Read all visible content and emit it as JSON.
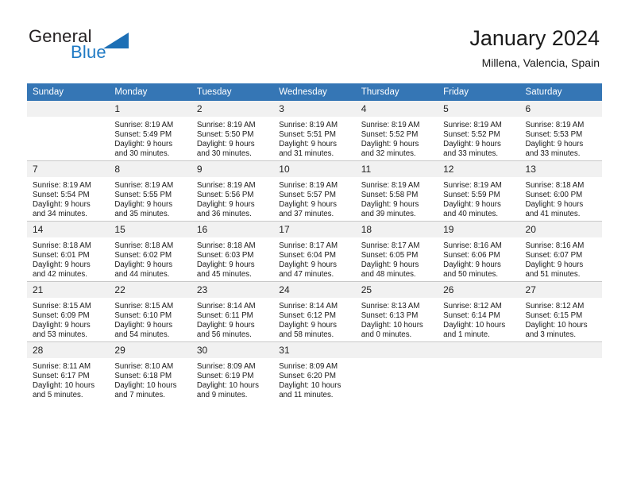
{
  "brand": {
    "name_part1": "General",
    "name_part2": "Blue",
    "logo_icon": "triangle-flag-icon"
  },
  "header": {
    "title": "January 2024",
    "subtitle": "Millena, Valencia, Spain"
  },
  "colors": {
    "header_blue": "#3576b5",
    "brand_blue": "#1f7ac4",
    "daynum_band": "#f1f1f1",
    "grid_line": "#c8c8c8"
  },
  "weekday_headers": [
    "Sunday",
    "Monday",
    "Tuesday",
    "Wednesday",
    "Thursday",
    "Friday",
    "Saturday"
  ],
  "labels": {
    "sunrise_prefix": "Sunrise:",
    "sunset_prefix": "Sunset:",
    "daylight_prefix": "Daylight:"
  },
  "weeks": [
    [
      {
        "day": "",
        "sunrise": "",
        "sunset": "",
        "daylight1": "",
        "daylight2": "",
        "empty": true
      },
      {
        "day": "1",
        "sunrise": "Sunrise: 8:19 AM",
        "sunset": "Sunset: 5:49 PM",
        "daylight1": "Daylight: 9 hours",
        "daylight2": "and 30 minutes.",
        "empty": false
      },
      {
        "day": "2",
        "sunrise": "Sunrise: 8:19 AM",
        "sunset": "Sunset: 5:50 PM",
        "daylight1": "Daylight: 9 hours",
        "daylight2": "and 30 minutes.",
        "empty": false
      },
      {
        "day": "3",
        "sunrise": "Sunrise: 8:19 AM",
        "sunset": "Sunset: 5:51 PM",
        "daylight1": "Daylight: 9 hours",
        "daylight2": "and 31 minutes.",
        "empty": false
      },
      {
        "day": "4",
        "sunrise": "Sunrise: 8:19 AM",
        "sunset": "Sunset: 5:52 PM",
        "daylight1": "Daylight: 9 hours",
        "daylight2": "and 32 minutes.",
        "empty": false
      },
      {
        "day": "5",
        "sunrise": "Sunrise: 8:19 AM",
        "sunset": "Sunset: 5:52 PM",
        "daylight1": "Daylight: 9 hours",
        "daylight2": "and 33 minutes.",
        "empty": false
      },
      {
        "day": "6",
        "sunrise": "Sunrise: 8:19 AM",
        "sunset": "Sunset: 5:53 PM",
        "daylight1": "Daylight: 9 hours",
        "daylight2": "and 33 minutes.",
        "empty": false
      }
    ],
    [
      {
        "day": "7",
        "sunrise": "Sunrise: 8:19 AM",
        "sunset": "Sunset: 5:54 PM",
        "daylight1": "Daylight: 9 hours",
        "daylight2": "and 34 minutes.",
        "empty": false
      },
      {
        "day": "8",
        "sunrise": "Sunrise: 8:19 AM",
        "sunset": "Sunset: 5:55 PM",
        "daylight1": "Daylight: 9 hours",
        "daylight2": "and 35 minutes.",
        "empty": false
      },
      {
        "day": "9",
        "sunrise": "Sunrise: 8:19 AM",
        "sunset": "Sunset: 5:56 PM",
        "daylight1": "Daylight: 9 hours",
        "daylight2": "and 36 minutes.",
        "empty": false
      },
      {
        "day": "10",
        "sunrise": "Sunrise: 8:19 AM",
        "sunset": "Sunset: 5:57 PM",
        "daylight1": "Daylight: 9 hours",
        "daylight2": "and 37 minutes.",
        "empty": false
      },
      {
        "day": "11",
        "sunrise": "Sunrise: 8:19 AM",
        "sunset": "Sunset: 5:58 PM",
        "daylight1": "Daylight: 9 hours",
        "daylight2": "and 39 minutes.",
        "empty": false
      },
      {
        "day": "12",
        "sunrise": "Sunrise: 8:19 AM",
        "sunset": "Sunset: 5:59 PM",
        "daylight1": "Daylight: 9 hours",
        "daylight2": "and 40 minutes.",
        "empty": false
      },
      {
        "day": "13",
        "sunrise": "Sunrise: 8:18 AM",
        "sunset": "Sunset: 6:00 PM",
        "daylight1": "Daylight: 9 hours",
        "daylight2": "and 41 minutes.",
        "empty": false
      }
    ],
    [
      {
        "day": "14",
        "sunrise": "Sunrise: 8:18 AM",
        "sunset": "Sunset: 6:01 PM",
        "daylight1": "Daylight: 9 hours",
        "daylight2": "and 42 minutes.",
        "empty": false
      },
      {
        "day": "15",
        "sunrise": "Sunrise: 8:18 AM",
        "sunset": "Sunset: 6:02 PM",
        "daylight1": "Daylight: 9 hours",
        "daylight2": "and 44 minutes.",
        "empty": false
      },
      {
        "day": "16",
        "sunrise": "Sunrise: 8:18 AM",
        "sunset": "Sunset: 6:03 PM",
        "daylight1": "Daylight: 9 hours",
        "daylight2": "and 45 minutes.",
        "empty": false
      },
      {
        "day": "17",
        "sunrise": "Sunrise: 8:17 AM",
        "sunset": "Sunset: 6:04 PM",
        "daylight1": "Daylight: 9 hours",
        "daylight2": "and 47 minutes.",
        "empty": false
      },
      {
        "day": "18",
        "sunrise": "Sunrise: 8:17 AM",
        "sunset": "Sunset: 6:05 PM",
        "daylight1": "Daylight: 9 hours",
        "daylight2": "and 48 minutes.",
        "empty": false
      },
      {
        "day": "19",
        "sunrise": "Sunrise: 8:16 AM",
        "sunset": "Sunset: 6:06 PM",
        "daylight1": "Daylight: 9 hours",
        "daylight2": "and 50 minutes.",
        "empty": false
      },
      {
        "day": "20",
        "sunrise": "Sunrise: 8:16 AM",
        "sunset": "Sunset: 6:07 PM",
        "daylight1": "Daylight: 9 hours",
        "daylight2": "and 51 minutes.",
        "empty": false
      }
    ],
    [
      {
        "day": "21",
        "sunrise": "Sunrise: 8:15 AM",
        "sunset": "Sunset: 6:09 PM",
        "daylight1": "Daylight: 9 hours",
        "daylight2": "and 53 minutes.",
        "empty": false
      },
      {
        "day": "22",
        "sunrise": "Sunrise: 8:15 AM",
        "sunset": "Sunset: 6:10 PM",
        "daylight1": "Daylight: 9 hours",
        "daylight2": "and 54 minutes.",
        "empty": false
      },
      {
        "day": "23",
        "sunrise": "Sunrise: 8:14 AM",
        "sunset": "Sunset: 6:11 PM",
        "daylight1": "Daylight: 9 hours",
        "daylight2": "and 56 minutes.",
        "empty": false
      },
      {
        "day": "24",
        "sunrise": "Sunrise: 8:14 AM",
        "sunset": "Sunset: 6:12 PM",
        "daylight1": "Daylight: 9 hours",
        "daylight2": "and 58 minutes.",
        "empty": false
      },
      {
        "day": "25",
        "sunrise": "Sunrise: 8:13 AM",
        "sunset": "Sunset: 6:13 PM",
        "daylight1": "Daylight: 10 hours",
        "daylight2": "and 0 minutes.",
        "empty": false
      },
      {
        "day": "26",
        "sunrise": "Sunrise: 8:12 AM",
        "sunset": "Sunset: 6:14 PM",
        "daylight1": "Daylight: 10 hours",
        "daylight2": "and 1 minute.",
        "empty": false
      },
      {
        "day": "27",
        "sunrise": "Sunrise: 8:12 AM",
        "sunset": "Sunset: 6:15 PM",
        "daylight1": "Daylight: 10 hours",
        "daylight2": "and 3 minutes.",
        "empty": false
      }
    ],
    [
      {
        "day": "28",
        "sunrise": "Sunrise: 8:11 AM",
        "sunset": "Sunset: 6:17 PM",
        "daylight1": "Daylight: 10 hours",
        "daylight2": "and 5 minutes.",
        "empty": false
      },
      {
        "day": "29",
        "sunrise": "Sunrise: 8:10 AM",
        "sunset": "Sunset: 6:18 PM",
        "daylight1": "Daylight: 10 hours",
        "daylight2": "and 7 minutes.",
        "empty": false
      },
      {
        "day": "30",
        "sunrise": "Sunrise: 8:09 AM",
        "sunset": "Sunset: 6:19 PM",
        "daylight1": "Daylight: 10 hours",
        "daylight2": "and 9 minutes.",
        "empty": false
      },
      {
        "day": "31",
        "sunrise": "Sunrise: 8:09 AM",
        "sunset": "Sunset: 6:20 PM",
        "daylight1": "Daylight: 10 hours",
        "daylight2": "and 11 minutes.",
        "empty": false
      },
      {
        "day": "",
        "sunrise": "",
        "sunset": "",
        "daylight1": "",
        "daylight2": "",
        "empty": true
      },
      {
        "day": "",
        "sunrise": "",
        "sunset": "",
        "daylight1": "",
        "daylight2": "",
        "empty": true
      },
      {
        "day": "",
        "sunrise": "",
        "sunset": "",
        "daylight1": "",
        "daylight2": "",
        "empty": true
      }
    ]
  ]
}
